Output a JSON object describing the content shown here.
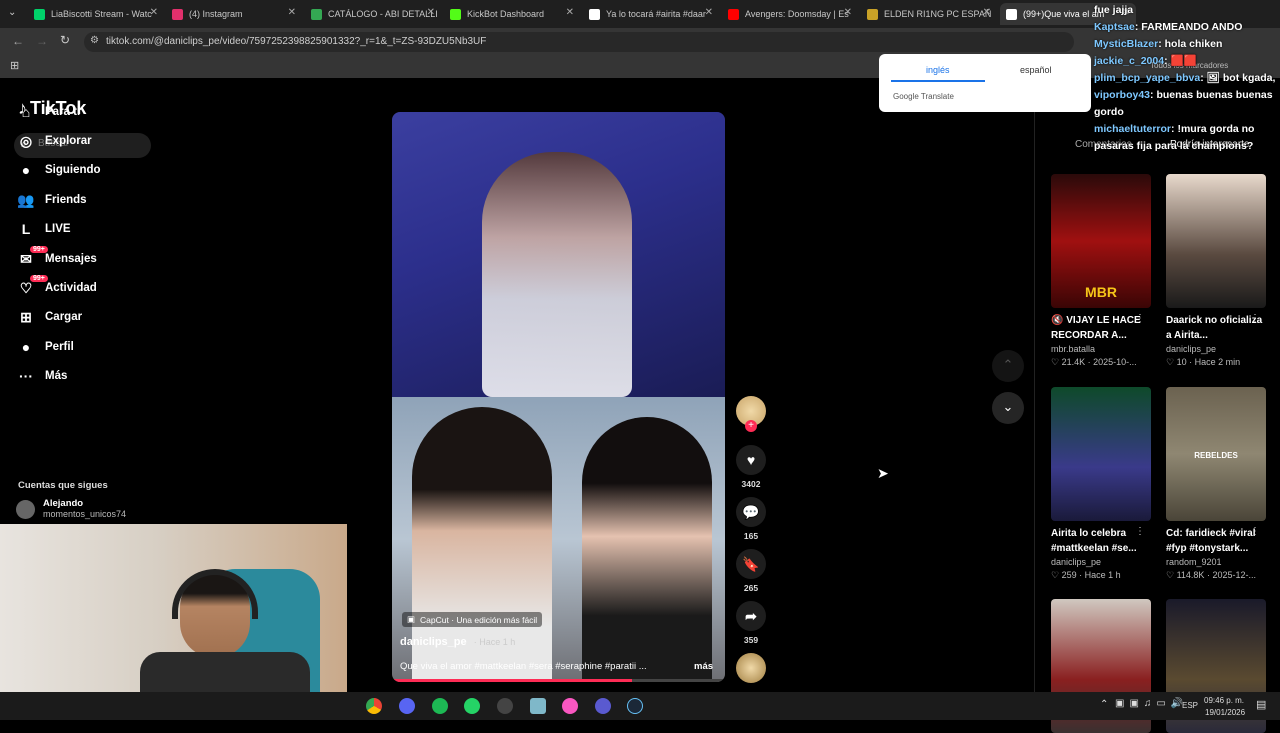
{
  "tabs": [
    {
      "label": "LiaBiscotti Stream - Watc",
      "color": "#00d26a"
    },
    {
      "label": "(4) Instagram",
      "color": "#e1306c"
    },
    {
      "label": "CATÁLOGO - ABI DETALLI",
      "color": "#34a853"
    },
    {
      "label": "KickBot Dashboard",
      "color": "#53fc18"
    },
    {
      "label": "Ya lo tocará #airita #daar",
      "color": "#ffffff"
    },
    {
      "label": "Avengers: Doomsday | Es",
      "color": "#ff0000"
    },
    {
      "label": "ELDEN RI1NG PC ESPAÑ",
      "color": "#c9a227"
    },
    {
      "label": "(99+)Que viva el am",
      "color": "#ffffff"
    }
  ],
  "address": {
    "url": "tiktok.com/@daniclips_pe/video/7597252398825901332?_r=1&_t=ZS-93DZU5Nb3UF",
    "bookmarks_text": "Todos los marcadores"
  },
  "translate_popup": {
    "tab1": "inglés",
    "tab2": "español",
    "brand": "Google Translate"
  },
  "tiktok": {
    "logo": "TikTok",
    "search_placeholder": "Buscar",
    "nav": [
      {
        "label": "Para ti",
        "icon": "home-icon"
      },
      {
        "label": "Explorar",
        "icon": "compass-icon"
      },
      {
        "label": "Siguiendo",
        "icon": "following-avatar"
      },
      {
        "label": "Friends",
        "icon": "friends-icon"
      },
      {
        "label": "LIVE",
        "icon": "live-icon"
      },
      {
        "label": "Mensajes",
        "icon": "messages-icon",
        "badge": "99+"
      },
      {
        "label": "Actividad",
        "icon": "activity-icon",
        "badge": "99+"
      },
      {
        "label": "Cargar",
        "icon": "upload-icon"
      },
      {
        "label": "Perfil",
        "icon": "profile-icon"
      },
      {
        "label": "Más",
        "icon": "more-icon"
      }
    ],
    "following_title": "Cuentas que sigues",
    "following_account": {
      "name": "Alejando",
      "handle": "momentos_unicos74"
    },
    "video": {
      "capcut": "CapCut · Una edición más fácil",
      "author": "daniclips_pe",
      "time": "· Hace 1 h",
      "caption": "Que viva el amor #mattkeelan #sera #seraphine #paratii ...",
      "more": "más",
      "likes": "3402",
      "comments": "165",
      "saves": "265",
      "shares": "359"
    },
    "panel_tabs": {
      "comments": "Comentarios",
      "interest": "Podría interesarte"
    },
    "recommendations": [
      {
        "title": "🔇 VIJAY LE HACE RECORDAR A...",
        "author": "mbr.batalla",
        "likes": "21.4K",
        "date": "2025-10-...",
        "thumb_text": "MBR"
      },
      {
        "title": "Daarick no oficializa a Airita...",
        "author": "daniclips_pe",
        "likes": "10",
        "date": "Hace 2 min",
        "thumb_text": ""
      },
      {
        "title": "Airita lo celebra #mattkeelan #se...",
        "author": "daniclips_pe",
        "likes": "259",
        "date": "Hace 1 h",
        "thumb_text": ""
      },
      {
        "title": "Cd: faridieck #viral #fyp #tonystark...",
        "author": "random_9201",
        "likes": "114.8K",
        "date": "2025-12-...",
        "thumb_text": "REBELDES"
      },
      {
        "title": "",
        "author": "",
        "likes": "",
        "date": "",
        "thumb_text": ""
      },
      {
        "title": "",
        "author": "",
        "likes": "",
        "date": "",
        "thumb_text": ""
      }
    ]
  },
  "chat": [
    {
      "user": "",
      "text": "fue jajja"
    },
    {
      "user": "Kaptsae",
      "text": ": FARMEANDO ANDO"
    },
    {
      "user": "MysticBlazer",
      "text": ": hola chiken"
    },
    {
      "user": "jackie_c_2004",
      "text": ": 🟥🟥"
    },
    {
      "user": "plim_bcp_yape_bbva",
      "text": ": 🖼 bot kgada,"
    },
    {
      "user": "viporboy43",
      "text": ": buenas buenas buenas gordo"
    },
    {
      "user": "michaeltuterror",
      "text": ": !mura gorda no pasaras fija para la champions?"
    }
  ],
  "taskbar": {
    "lang": "ESP",
    "time": "09:46 p. m.",
    "date": "19/01/2026"
  }
}
